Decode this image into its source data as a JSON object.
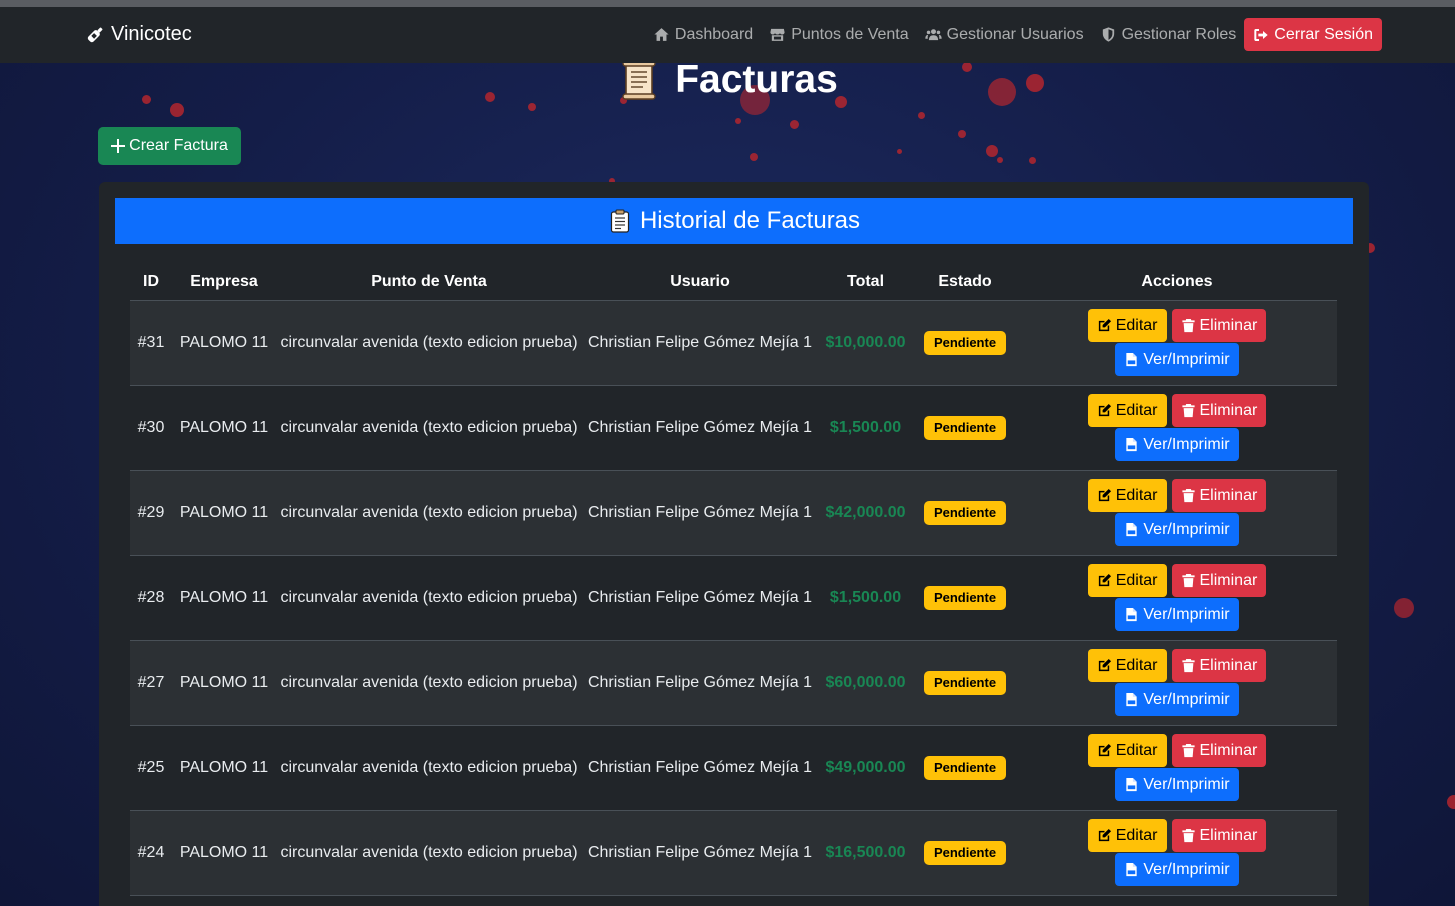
{
  "navbar": {
    "brand": "Vinicotec",
    "links": [
      {
        "label": "Dashboard",
        "icon": "home-icon"
      },
      {
        "label": "Puntos de Venta",
        "icon": "store-icon"
      },
      {
        "label": "Gestionar Usuarios",
        "icon": "users-icon"
      },
      {
        "label": "Gestionar Roles",
        "icon": "shield-icon"
      }
    ],
    "logout_label": "Cerrar Sesión"
  },
  "page": {
    "title": "Facturas",
    "create_label": "Crear Factura"
  },
  "card": {
    "title": "Historial de Facturas"
  },
  "table": {
    "headers": [
      "ID",
      "Empresa",
      "Punto de Venta",
      "Usuario",
      "Total",
      "Estado",
      "Acciones"
    ],
    "actions": {
      "edit": "Editar",
      "delete": "Eliminar",
      "view": "Ver/Imprimir"
    },
    "rows": [
      {
        "id": "#31",
        "empresa": "PALOMO 11",
        "punto": "circunvalar avenida (texto edicion prueba)",
        "usuario": "Christian Felipe Gómez Mejía 1",
        "total": "$10,000.00",
        "estado": "Pendiente"
      },
      {
        "id": "#30",
        "empresa": "PALOMO 11",
        "punto": "circunvalar avenida (texto edicion prueba)",
        "usuario": "Christian Felipe Gómez Mejía 1",
        "total": "$1,500.00",
        "estado": "Pendiente"
      },
      {
        "id": "#29",
        "empresa": "PALOMO 11",
        "punto": "circunvalar avenida (texto edicion prueba)",
        "usuario": "Christian Felipe Gómez Mejía 1",
        "total": "$42,000.00",
        "estado": "Pendiente"
      },
      {
        "id": "#28",
        "empresa": "PALOMO 11",
        "punto": "circunvalar avenida (texto edicion prueba)",
        "usuario": "Christian Felipe Gómez Mejía 1",
        "total": "$1,500.00",
        "estado": "Pendiente"
      },
      {
        "id": "#27",
        "empresa": "PALOMO 11",
        "punto": "circunvalar avenida (texto edicion prueba)",
        "usuario": "Christian Felipe Gómez Mejía 1",
        "total": "$60,000.00",
        "estado": "Pendiente"
      },
      {
        "id": "#25",
        "empresa": "PALOMO 11",
        "punto": "circunvalar avenida (texto edicion prueba)",
        "usuario": "Christian Felipe Gómez Mejía 1",
        "total": "$49,000.00",
        "estado": "Pendiente"
      },
      {
        "id": "#24",
        "empresa": "PALOMO 11",
        "punto": "circunvalar avenida (texto edicion prueba)",
        "usuario": "Christian Felipe Gómez Mejía 1",
        "total": "$16,500.00",
        "estado": "Pendiente"
      }
    ]
  }
}
